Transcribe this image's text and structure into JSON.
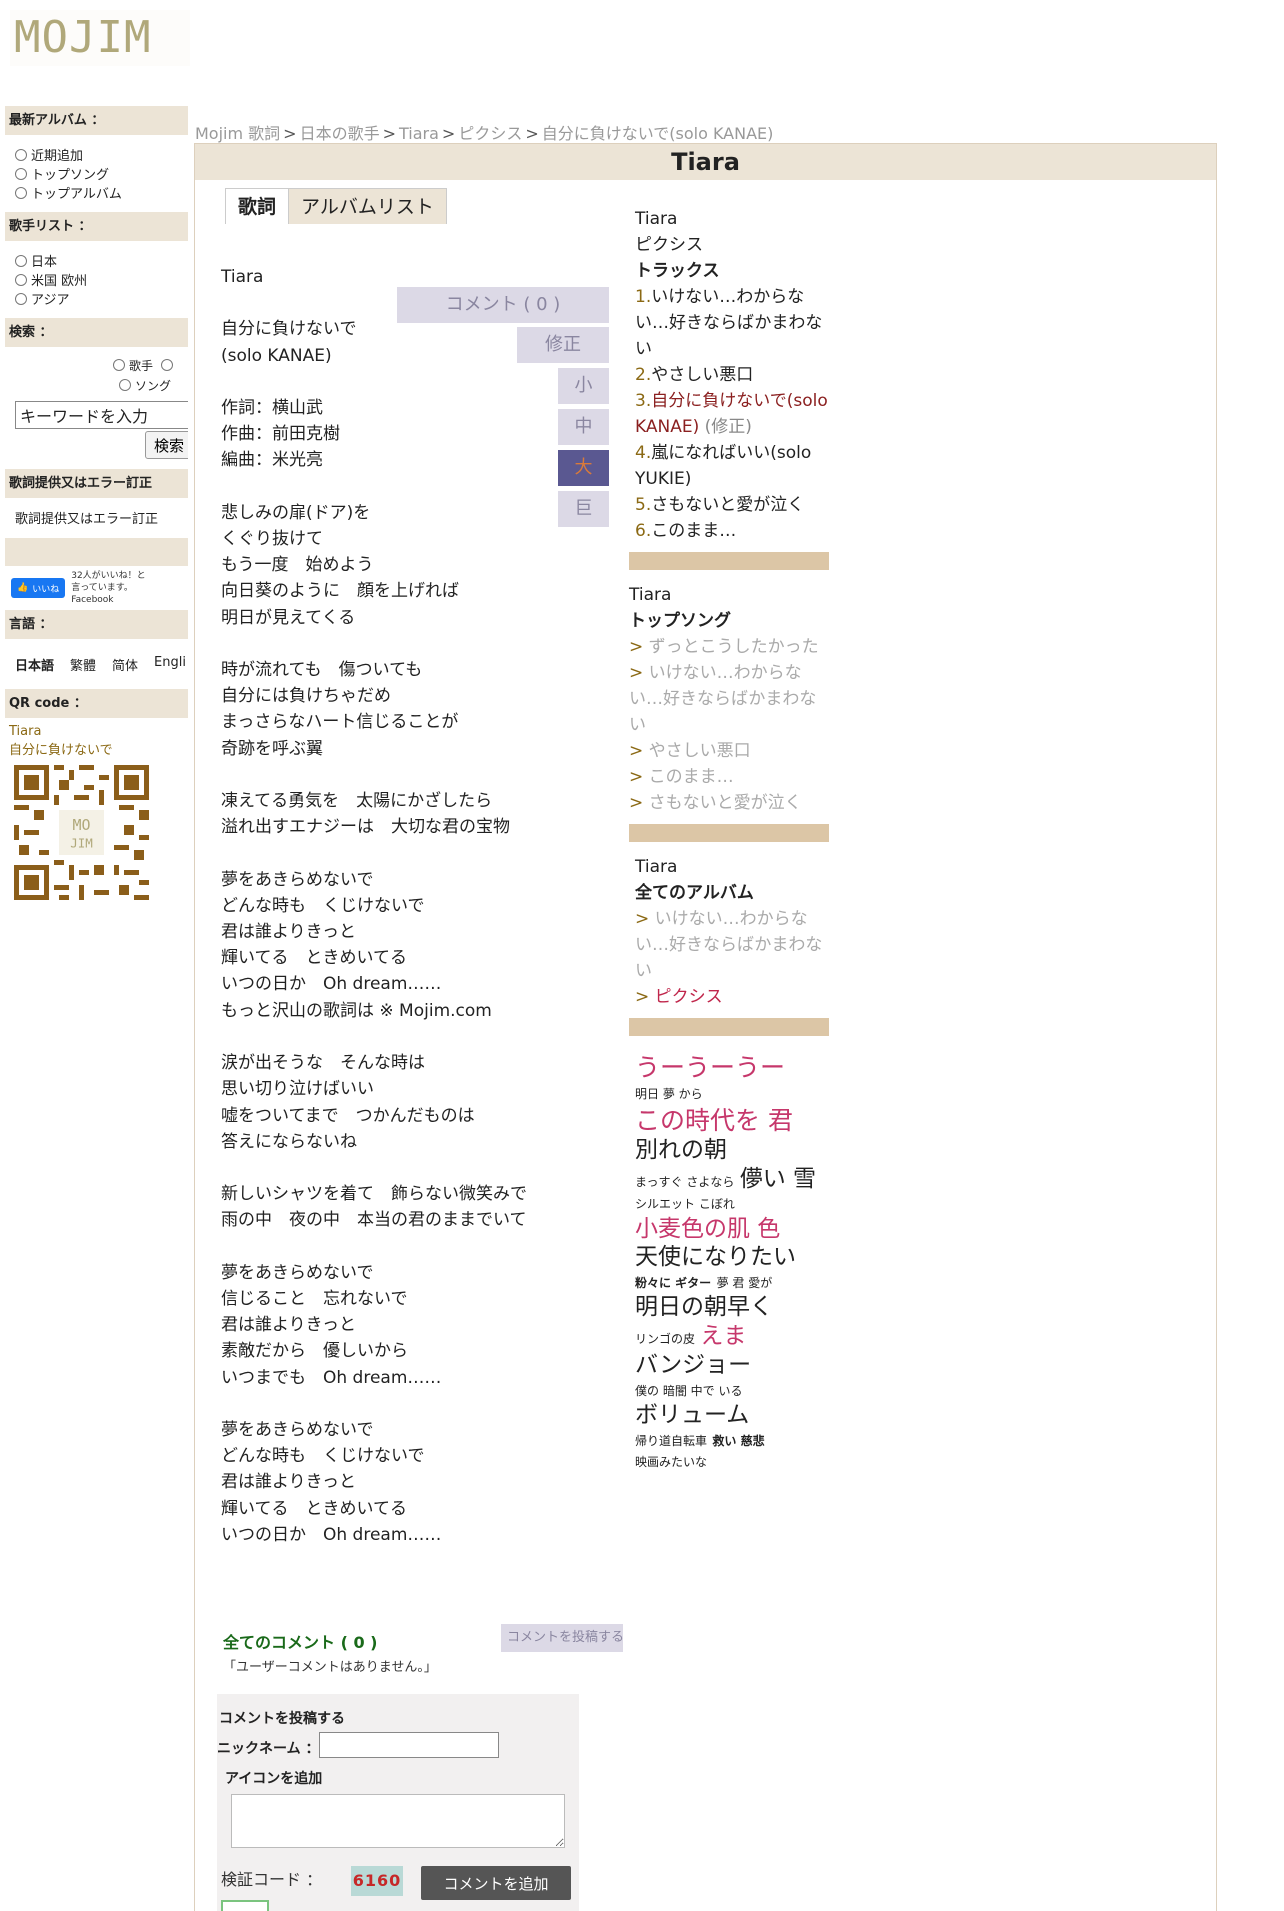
{
  "logo": "MOJIM",
  "sidebar": {
    "latest_album_title": "最新アルバム ：",
    "latest_album_options": [
      "近期追加",
      "トップソング",
      "トップアルバム"
    ],
    "artist_list_title": "歌手リスト ：",
    "artist_list_options": [
      "日本",
      "米国 欧州",
      "アジア"
    ],
    "search_title": "検索 ：",
    "search_option_artist": "歌手",
    "search_option_song": "ソング",
    "search_placeholder": "キーワードを入力",
    "search_button": "検索",
    "report_title": "歌詞提供又はエラー訂正",
    "report_link": "歌詞提供又はエラー訂正",
    "fb_like": "いいね",
    "fb_count": "32人がいいね！と言っています。Facebook",
    "language_title": "言語 ：",
    "languages": [
      "日本語",
      "繁體",
      "简体",
      "Engli"
    ],
    "qr_title": "QR code ：",
    "qr_artist": "Tiara",
    "qr_song": "自分に負けないで"
  },
  "breadcrumb": [
    "Mojim 歌詞",
    "日本の歌手",
    "Tiara",
    "ピクシス",
    "自分に負けないで(solo KANAE)"
  ],
  "main": {
    "title": "Tiara",
    "tabs": [
      "歌詞",
      "アルバムリスト"
    ],
    "comment_button": "コメント ( 0 )",
    "edit_button": "修正",
    "size_buttons": [
      "小",
      "中",
      "大",
      "巨"
    ],
    "lyrics": "Tiara\n\n自分に負けないで\n(solo KANAE)\n\n作詞：横山武\n作曲：前田克樹\n編曲：米光亮\n\n悲しみの扉(ドア)を\nくぐり抜けて\nもう一度　始めよう\n向日葵のように　顔を上げれば\n明日が見えてくる\n\n時が流れても　傷ついても\n自分には負けちゃだめ\nまっさらなハート信じることが\n奇跡を呼ぶ翼\n\n凍えてる勇気を　太陽にかざしたら\n溢れ出すエナジーは　大切な君の宝物\n\n夢をあきらめないで\nどんな時も　くじけないで\n君は誰よりきっと\n輝いてる　ときめいてる\nいつの日か　Oh dream……\nもっと沢山の歌詞は ※ Mojim.com\n\n涙が出そうな　そんな時は\n思い切り泣けばいい\n嘘をついてまで　つかんだものは\n答えにならないね\n\n新しいシャツを着て　飾らない微笑みで\n雨の中　夜の中　本当の君のままでいて\n\n夢をあきらめないで\n信じること　忘れないで\n君は誰よりきっと\n素敵だから　優しいから\nいつまでも　Oh dream……\n\n夢をあきらめないで\nどんな時も　くじけないで\n君は誰よりきっと\n輝いてる　ときめいてる\nいつの日か　Oh dream……"
  },
  "right": {
    "artist": "Tiara",
    "album": "ピクシス",
    "tracks_title": "トラックス",
    "tracks": [
      {
        "num": "1.",
        "title": "いけない…わからない…好きならばかまわない"
      },
      {
        "num": "2.",
        "title": "やさしい悪口"
      },
      {
        "num": "3.",
        "title": "自分に負けないで(solo KANAE)",
        "edit": "(修正)"
      },
      {
        "num": "4.",
        "title": "嵐になればいい(solo YUKIE)"
      },
      {
        "num": "5.",
        "title": "さもないと愛が泣く"
      },
      {
        "num": "6.",
        "title": "このまま…"
      }
    ],
    "top_artist": "Tiara",
    "top_title": "トップソング",
    "top_songs": [
      "ずっとこうしたかった",
      "いけない…わからない…好きならばかまわない",
      "やさしい悪口",
      "このまま…",
      "さもないと愛が泣く"
    ],
    "albums_artist": "Tiara",
    "albums_title": "全てのアルバム",
    "albums": [
      "いけない…わからない…好きならばかまわない",
      "ピクシス"
    ],
    "tags": {
      "t1": "うーうーうー",
      "t2": "明日 夢 から",
      "t3": "この時代を 君",
      "t4": "別れの朝",
      "t5": "まっすぐ さよなら",
      "t6": "儚い 雪",
      "t7": "シルエット こぼれ",
      "t8": "小麦色の肌 色",
      "t9": "天使になりたい",
      "t10": "粉々に ギター",
      "t11": "夢 君 愛が",
      "t12": "明日の朝早く",
      "t13": "リンゴの皮",
      "t14": "えま",
      "t15": "バンジョー",
      "t16": "僕の 暗闇 中で いる",
      "t17": "ボリューム",
      "t18": "帰り道自転車",
      "t19": "救い 慈悲",
      "t20": "映画みたいな"
    }
  },
  "comments": {
    "title": "全てのコメント ( 0 )",
    "post_link": "コメントを投稿する",
    "empty": "「ユーザーコメントはありません。」",
    "form_title": "コメントを投稿する",
    "nickname_label": "ニックネーム ：",
    "icon_label": "アイコンを追加",
    "verify_label": "検証コード ：",
    "captcha": "6160",
    "add_button": "コメントを追加"
  }
}
